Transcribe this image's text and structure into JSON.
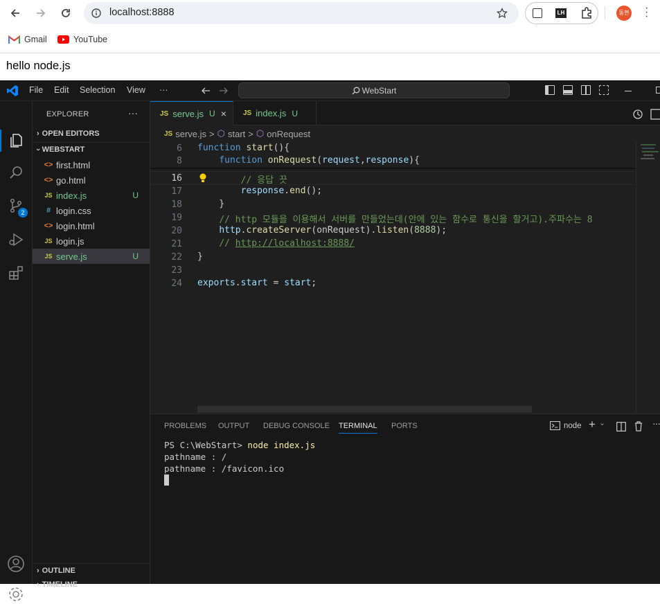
{
  "browser": {
    "url": "localhost:8888",
    "bookmarks": [
      {
        "label": "Gmail",
        "icon": "gmail-icon"
      },
      {
        "label": "YouTube",
        "icon": "youtube-icon"
      }
    ],
    "profile_label": "동현",
    "extension_label": "LH",
    "page_text": "hello node.js"
  },
  "vscode": {
    "menu": [
      "File",
      "Edit",
      "Selection",
      "View",
      "···"
    ],
    "command_center": "WebStart",
    "explorer": {
      "title": "EXPLORER",
      "more": "···",
      "open_editors": "OPEN EDITORS",
      "folder": "WEBSTART",
      "files": [
        {
          "name": "first.html",
          "icon": "<>",
          "type": "html",
          "badge": ""
        },
        {
          "name": "go.html",
          "icon": "<>",
          "type": "html",
          "badge": ""
        },
        {
          "name": "index.js",
          "icon": "JS",
          "type": "js",
          "badge": "U"
        },
        {
          "name": "login.css",
          "icon": "#",
          "type": "css",
          "badge": ""
        },
        {
          "name": "login.html",
          "icon": "<>",
          "type": "html",
          "badge": ""
        },
        {
          "name": "login.js",
          "icon": "JS",
          "type": "js",
          "badge": ""
        },
        {
          "name": "serve.js",
          "icon": "JS",
          "type": "js",
          "badge": "U"
        }
      ],
      "outline": "OUTLINE",
      "timeline": "TIMELINE"
    },
    "scm_badge": "2",
    "tabs": [
      {
        "icon": "JS",
        "name": "serve.js",
        "badge": "U",
        "close": "×"
      },
      {
        "icon": "JS",
        "name": "index.js",
        "badge": "U"
      }
    ],
    "breadcrumb": {
      "file_icon": "JS",
      "file": "serve.js",
      "sep": ">",
      "fn1": "start",
      "fn2": "onRequest"
    },
    "code_lines": [
      {
        "n": "6",
        "text": "function start(){"
      },
      {
        "n": "8",
        "text": "    function onRequest(request,response){"
      },
      {
        "n": "16",
        "text": "        // 응답 끗"
      },
      {
        "n": "17",
        "text": "        response.end();"
      },
      {
        "n": "18",
        "text": "    }"
      },
      {
        "n": "19",
        "text": "    // http 모듈을 이용해서 서버를 만들었는데(안에 있는 함수로 통신을 할거고).주파수는 8"
      },
      {
        "n": "20",
        "text": "    http.createServer(onRequest).listen(8888);"
      },
      {
        "n": "21",
        "text": "    // http://localhost:8888/"
      },
      {
        "n": "22",
        "text": "}"
      },
      {
        "n": "23",
        "text": ""
      },
      {
        "n": "24",
        "text": "exports.start = start;"
      }
    ],
    "panel_tabs": [
      "PROBLEMS",
      "OUTPUT",
      "DEBUG CONSOLE",
      "TERMINAL",
      "PORTS"
    ],
    "active_panel_tab": "TERMINAL",
    "terminal_name": "node",
    "terminal_lines": [
      {
        "prompt": "PS C:\\WebStart> ",
        "cmd": "node index.js"
      },
      {
        "prompt": "pathname : /",
        "cmd": ""
      },
      {
        "prompt": "pathname : /favicon.ico",
        "cmd": ""
      }
    ]
  },
  "colors": {
    "accent": "#0078d4",
    "untracked": "#73c991",
    "js_icon": "#cbcb41",
    "html_icon": "#e37933",
    "css_icon": "#519aba"
  }
}
